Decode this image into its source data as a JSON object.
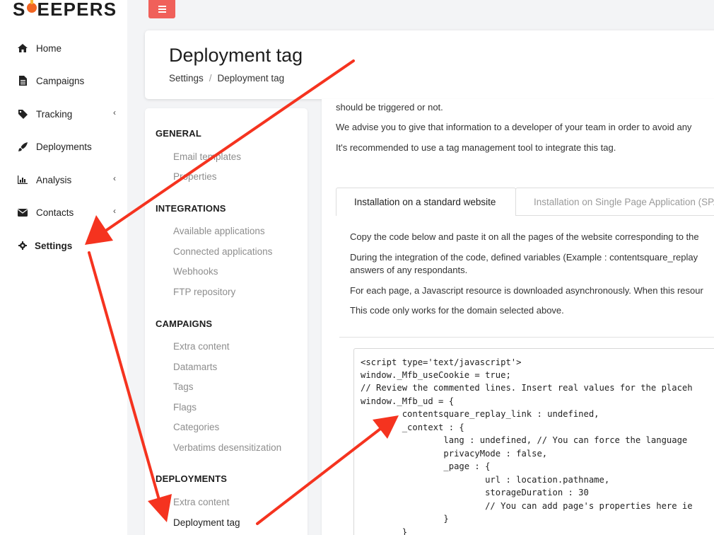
{
  "brand": {
    "logo_pre": "S",
    "logo_post": "EEPERS",
    "accent": "#f26522"
  },
  "leftnav": {
    "items": [
      {
        "label": "Home",
        "icon": "home-icon",
        "has_chevron": false
      },
      {
        "label": "Campaigns",
        "icon": "file-icon",
        "has_chevron": false
      },
      {
        "label": "Tracking",
        "icon": "tag-icon",
        "has_chevron": true
      },
      {
        "label": "Deployments",
        "icon": "rocket-icon",
        "has_chevron": false
      },
      {
        "label": "Analysis",
        "icon": "bar-chart-icon",
        "has_chevron": true
      },
      {
        "label": "Contacts",
        "icon": "envelope-icon",
        "has_chevron": true
      },
      {
        "label": "Settings",
        "icon": "gear-icon",
        "has_chevron": false,
        "active": true
      }
    ],
    "chevron": "‹"
  },
  "header": {
    "title": "Deployment tag",
    "breadcrumb": [
      "Settings",
      "Deployment tag"
    ],
    "breadcrumb_sep": "/"
  },
  "settings_menu": {
    "general": {
      "title": "GENERAL",
      "links": [
        "Email templates",
        "Properties"
      ]
    },
    "integrations": {
      "title": "INTEGRATIONS",
      "links": [
        "Available applications",
        "Connected applications",
        "Webhooks",
        "FTP repository"
      ]
    },
    "campaigns": {
      "title": "CAMPAIGNS",
      "links": [
        "Extra content",
        "Datamarts",
        "Tags",
        "Flags",
        "Categories",
        "Verbatims desensitization"
      ]
    },
    "deployments": {
      "title": "DEPLOYMENTS",
      "links": [
        "Extra content",
        "Deployment tag"
      ]
    }
  },
  "content": {
    "intro": [
      "should be triggered or not.",
      "We advise you to give that information to a developer of your team in order to avoid any",
      "It's recommended to use a tag management tool to integrate this tag."
    ],
    "tabs": [
      "Installation on a standard website",
      "Installation on Single Page Application (SPA"
    ],
    "instructions": [
      "Copy the code below and paste it on all the pages of the website corresponding to the",
      "During the integration of the code, defined variables (Example : contentsquare_replay",
      "answers of any respondants.",
      "For each page, a Javascript resource is downloaded asynchronously. When this resour",
      "This code only works for the domain selected above."
    ],
    "code": [
      "<script type='text/javascript'>",
      "window._Mfb_useCookie = true;",
      "// Review the commented lines. Insert real values for the placeh",
      "window._Mfb_ud = {",
      "        contentsquare_replay_link : undefined,",
      "        _context : {",
      "                lang : undefined, // You can force the language",
      "                privacyMode : false,",
      "                _page : {",
      "                        url : location.pathname,",
      "                        storageDuration : 30",
      "                        // You can add page's properties here ie",
      "                }",
      "        }"
    ]
  },
  "annotations": {
    "arrow_color": "#f5331f"
  }
}
